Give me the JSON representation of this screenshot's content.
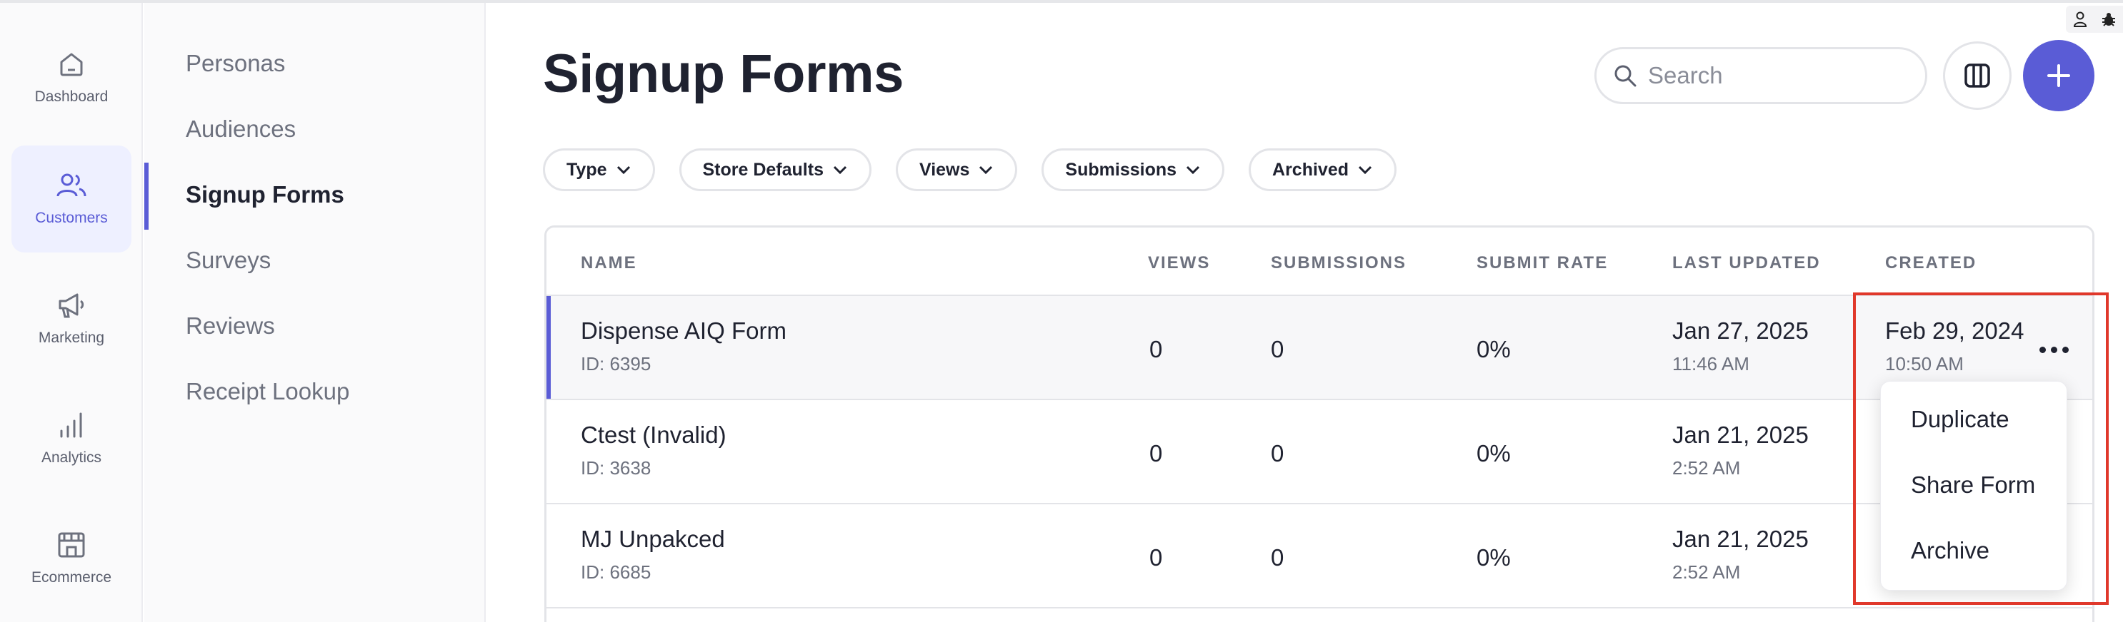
{
  "rail": {
    "items": [
      {
        "label": "Dashboard",
        "icon": "home-icon",
        "active": false
      },
      {
        "label": "Customers",
        "icon": "users-icon",
        "active": true
      },
      {
        "label": "Marketing",
        "icon": "megaphone-icon",
        "active": false
      },
      {
        "label": "Analytics",
        "icon": "bar-chart-icon",
        "active": false
      },
      {
        "label": "Ecommerce",
        "icon": "store-icon",
        "active": false
      }
    ]
  },
  "subnav": {
    "items": [
      {
        "label": "Personas"
      },
      {
        "label": "Audiences"
      },
      {
        "label": "Signup Forms"
      },
      {
        "label": "Surveys"
      },
      {
        "label": "Reviews"
      },
      {
        "label": "Receipt Lookup"
      }
    ],
    "active_index": 2
  },
  "page": {
    "title": "Signup Forms"
  },
  "search": {
    "placeholder": "Search",
    "value": ""
  },
  "filters": [
    {
      "label": "Type"
    },
    {
      "label": "Store Defaults"
    },
    {
      "label": "Views"
    },
    {
      "label": "Submissions"
    },
    {
      "label": "Archived"
    }
  ],
  "table": {
    "columns": [
      "NAME",
      "VIEWS",
      "SUBMISSIONS",
      "SUBMIT RATE",
      "LAST UPDATED",
      "CREATED"
    ],
    "rows": [
      {
        "name": "Dispense AIQ Form",
        "id": "ID: 6395",
        "views": "0",
        "submissions": "0",
        "submit_rate": "0%",
        "updated_date": "Jan 27, 2025",
        "updated_time": "11:46 AM",
        "created_date": "Feb 29, 2024",
        "created_time": "10:50 AM"
      },
      {
        "name": "Ctest (Invalid)",
        "id": "ID: 3638",
        "views": "0",
        "submissions": "0",
        "submit_rate": "0%",
        "updated_date": "Jan 21, 2025",
        "updated_time": "2:52 AM",
        "created_date": "",
        "created_time": ""
      },
      {
        "name": "MJ Unpakced",
        "id": "ID: 6685",
        "views": "0",
        "submissions": "0",
        "submit_rate": "0%",
        "updated_date": "Jan 21, 2025",
        "updated_time": "2:52 AM",
        "created_date": "",
        "created_time": ""
      }
    ]
  },
  "row_menu": {
    "items": [
      "Duplicate",
      "Share Form",
      "Archive"
    ]
  },
  "colors": {
    "accent": "#5a5cd6",
    "annotation": "#e0382b"
  }
}
